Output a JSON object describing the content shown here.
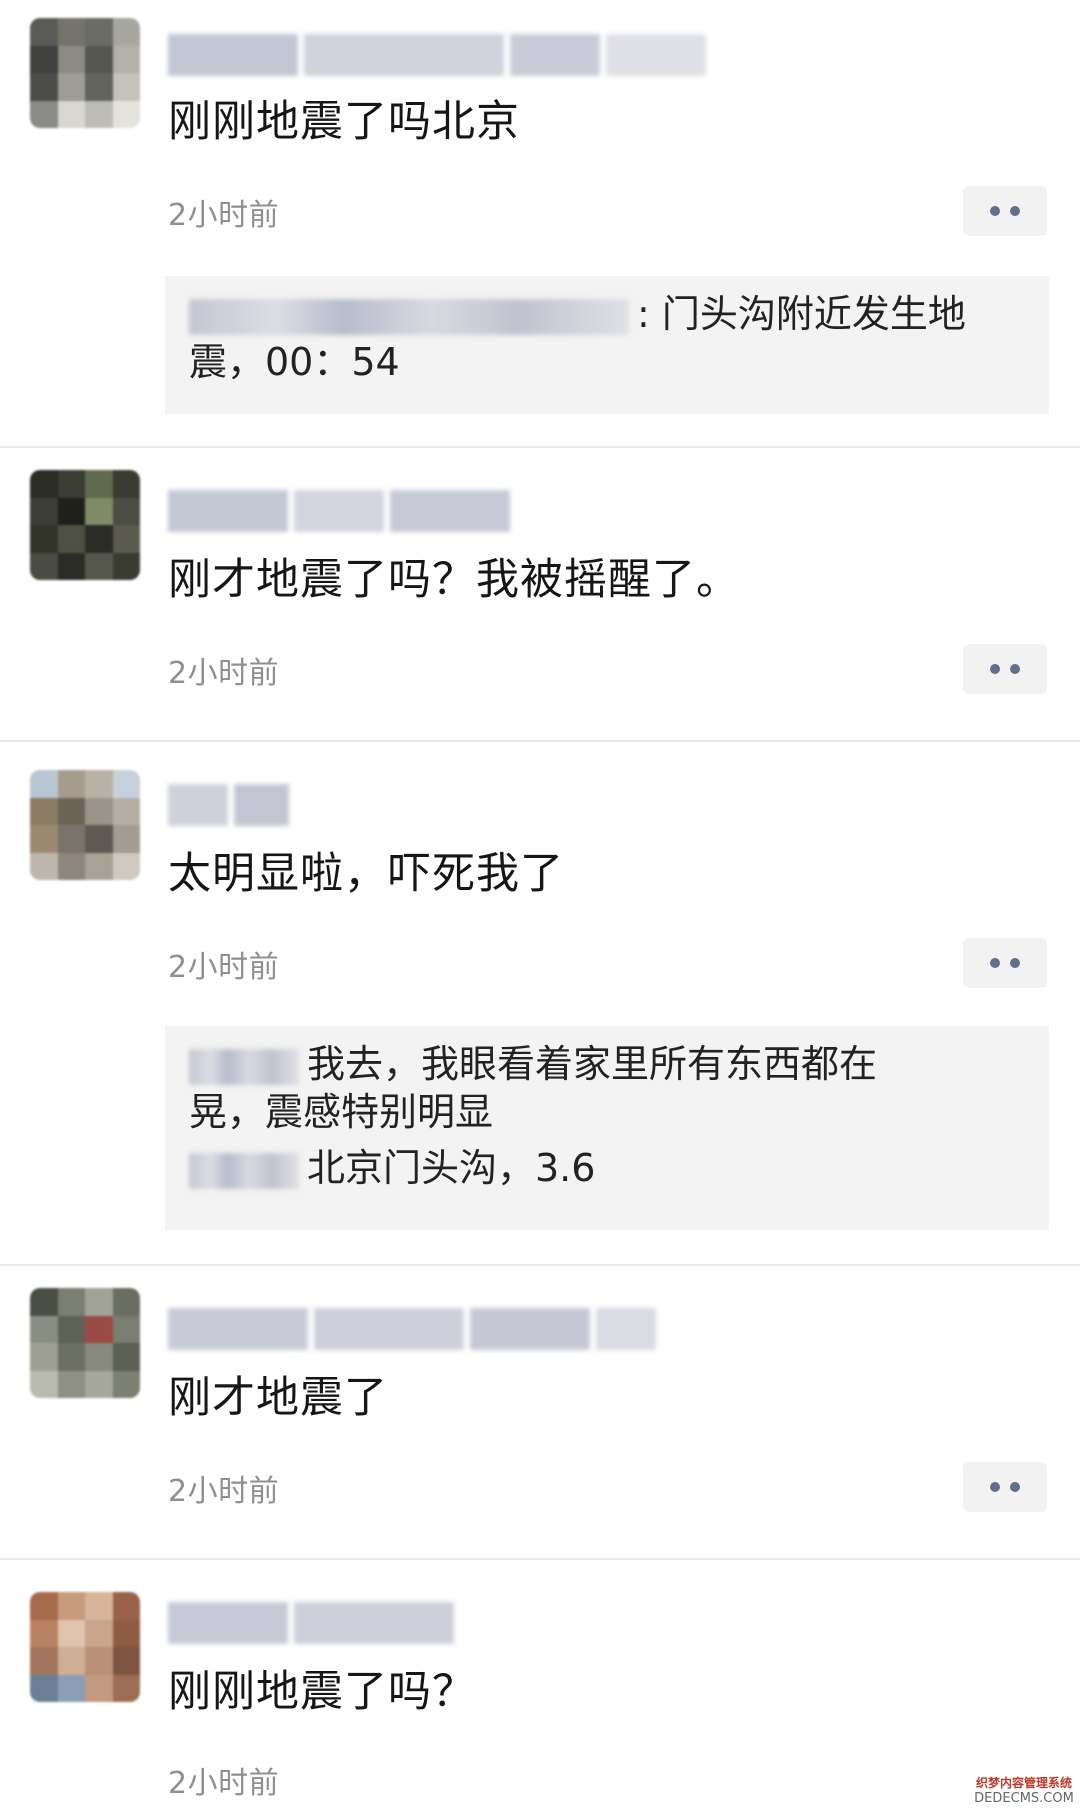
{
  "comments": [
    {
      "text": "刚刚地震了吗北京",
      "time": "2小时前",
      "reply": {
        "lines": [
          {
            "text": ": 门头沟附近发生地"
          },
          {
            "text": "震，00：54"
          }
        ]
      }
    },
    {
      "text": "刚才地震了吗？我被摇醒了。",
      "time": "2小时前"
    },
    {
      "text": "太明显啦，吓死我了",
      "time": "2小时前",
      "reply": {
        "lines": [
          {
            "text": "我去，我眼看着家里所有东西都在"
          },
          {
            "text": "晃，震感特别明显"
          },
          {
            "text": "北京门头沟，3.6"
          }
        ]
      }
    },
    {
      "text": "刚才地震了",
      "time": "2小时前"
    },
    {
      "text": "刚刚地震了吗？",
      "time": "2小时前"
    }
  ],
  "watermark": {
    "line1": "织梦内容管理系统",
    "line2": "DEDECMS.COM"
  },
  "icons": {
    "more": "more-dots-icon"
  },
  "colors": {
    "background": "#ffffff",
    "time": "#8f8f8f",
    "reply_bg": "#f3f3f3",
    "dot": "#5f6f8c"
  }
}
